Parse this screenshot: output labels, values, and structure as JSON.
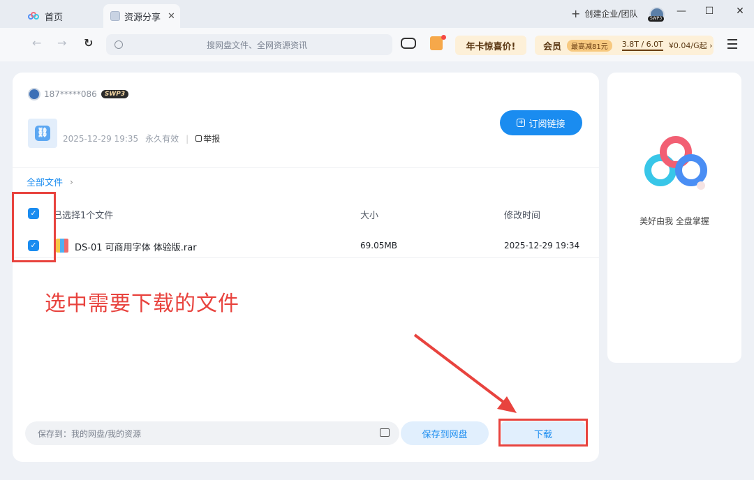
{
  "tabs": [
    {
      "label": "首页"
    },
    {
      "label": "资源分享"
    }
  ],
  "titlebar": {
    "create_team": "创建企业/团队",
    "avatar_badge": "SWP3",
    "window_controls": [
      "minimize-icon",
      "maximize-icon",
      "close-icon"
    ]
  },
  "toolbar": {
    "search_placeholder": "搜网盘文件、全网资源资讯",
    "promo_label": "年卡惊喜价!",
    "vip_label": "会员",
    "vip_badge": "最高减81元",
    "vip_storage": "3.8T / 6.0T",
    "vip_price": "¥0.04/G起 ›"
  },
  "share": {
    "owner": "187*****086",
    "owner_badge": "SWP3",
    "date": "2025-12-29 19:35",
    "validity": "永久有效",
    "report_label": "举报",
    "subscribe_label": "订阅链接"
  },
  "breadcrumb": {
    "label": "全部文件"
  },
  "file_table": {
    "header": {
      "selection": "已选择1个文件",
      "size": "大小",
      "modified": "修改时间"
    },
    "rows": [
      {
        "name": "DS-01 可商用字体 体验版.rar",
        "size": "69.05MB",
        "modified": "2025-12-29 19:34",
        "checked": true
      }
    ]
  },
  "annotation": {
    "text": "选中需要下载的文件",
    "color": "#e8433e"
  },
  "bottom": {
    "save_path": "保存到：我的网盘/我的资源",
    "save_button": "保存到网盘",
    "download_button": "下载"
  },
  "right_panel": {
    "slogan": "美好由我  全盘掌握"
  },
  "colors": {
    "accent": "#1a8cf0",
    "highlight": "#e8433e"
  }
}
